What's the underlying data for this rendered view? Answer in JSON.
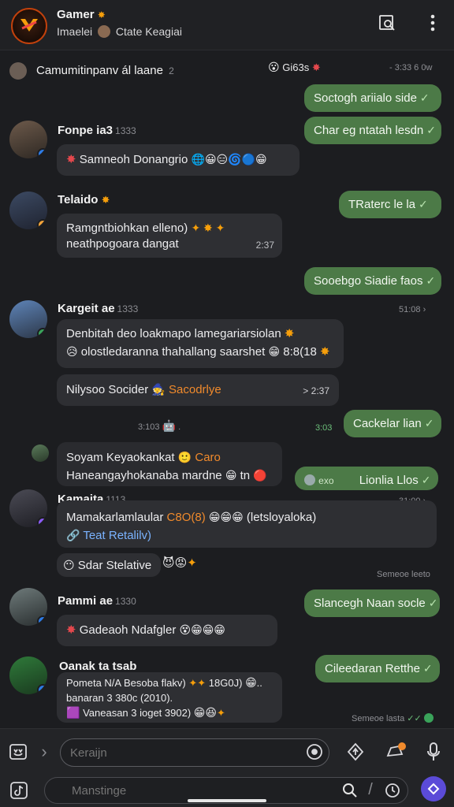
{
  "header": {
    "title": "Gamer",
    "subtitle": "Imaelei",
    "subtitle_2": "Ctate Keagiai"
  },
  "messages": {
    "m0": {
      "name": "Camumitinpanv ál laane",
      "count": "2",
      "emoji": "Gi63s",
      "time": "- 3:33 6 0w"
    },
    "o1": {
      "text": "Soctogh ariialo side"
    },
    "o2": {
      "text": "Char eg ntatah lesdn"
    },
    "p1": {
      "name": "Fonpe ia3",
      "meta": "1333",
      "text": "Samneoh  Donangrio"
    },
    "p2": {
      "name": "Telaido",
      "line1": "Ramgntbiohkan elleno)",
      "line2": "neathpogoara dangat",
      "time": "2:37"
    },
    "o3": {
      "text": "TRaterc le la"
    },
    "o4": {
      "text": "Sooebgo Siadie faos"
    },
    "p3": {
      "name": "Kargeit ae",
      "meta": "1333",
      "time": "51:08",
      "line1": "Denbitah deo loakmapo lamegariarsiolan",
      "line2": "olostledaranna thahallang saarshet",
      "line2_tail": "8:8(18",
      "sub_text": "Nilysoo Socider",
      "sub_orange": "Sacodrlye",
      "sub_time": "> 2:37"
    },
    "t1": {
      "left": "3:103",
      "right": "3:03"
    },
    "o5": {
      "text": "Cackelar lian"
    },
    "p4": {
      "line1": "Soyam Keyaokankat",
      "line1_orange": "Caro",
      "line2": "Haneangayhokanaba mardne",
      "line2_tail": "tn"
    },
    "o6": {
      "prefix": "exo",
      "text": "Lionlia Llos"
    },
    "p5": {
      "name": "Kamaita",
      "meta": "1113",
      "time": "31:00",
      "line1": "Mamakarlamlaular",
      "line1_orange": "C8O(8)",
      "line1_tail": "(letsloyaloka)",
      "link": "Teat Retalilv)",
      "chip": "Sdar Stelative"
    },
    "t2": {
      "text": "Semeoe leeto"
    },
    "o7": {
      "text": "Slancegh Naan socle"
    },
    "p6": {
      "name": "Pammi ae",
      "meta": "1330",
      "text": "Gadeaoh Ndafgler"
    },
    "p7": {
      "name": "Oanak ta tsab",
      "line1": "Pometa N/A Besoba flakv)",
      "line1_tail": "18G0J)",
      "line2": "banaran 3 380c (2010).",
      "line3": "Vaneasan 3 ioget",
      "line3_tail": "3902)"
    },
    "o8": {
      "text": "Cileedaran Retthe"
    },
    "t3": {
      "text": "Semeoe lasta"
    }
  },
  "composer": {
    "message_placeholder": "Keraijn",
    "search_placeholder": "Manstinge"
  },
  "colors": {
    "accent": "#4c7a47",
    "background": "#1c1d20",
    "bubble": "#2e2f33",
    "orange": "#f08a2c"
  },
  "icons": [
    "logo-icon",
    "note-search-icon",
    "more-vert-icon",
    "sticker-icon",
    "attach-icon",
    "emoji-icon",
    "gift-icon",
    "notification-icon",
    "mic-icon",
    "tiktok-icon",
    "search-icon",
    "clock-icon",
    "profile-icon"
  ]
}
